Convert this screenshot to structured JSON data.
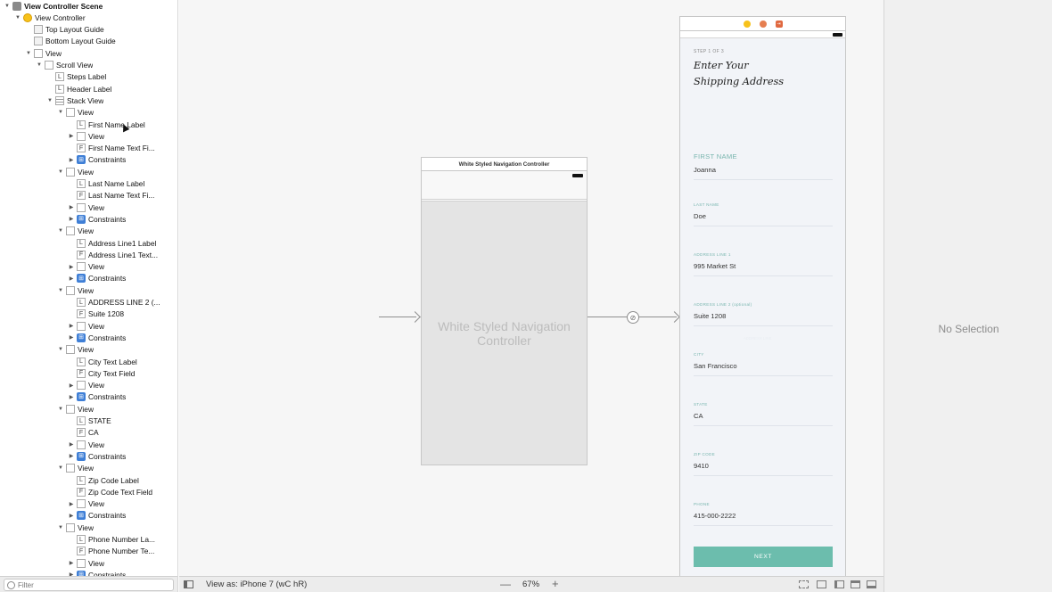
{
  "outline": {
    "items": [
      {
        "label": "View Controller Scene",
        "icon": "scene",
        "depth": 0,
        "arrow": "down",
        "bold": true
      },
      {
        "label": "View Controller",
        "icon": "vc",
        "depth": 1,
        "arrow": "down"
      },
      {
        "label": "Top Layout Guide",
        "icon": "guide",
        "depth": 2,
        "arrow": ""
      },
      {
        "label": "Bottom Layout Guide",
        "icon": "guide",
        "depth": 2,
        "arrow": ""
      },
      {
        "label": "View",
        "icon": "view",
        "depth": 2,
        "arrow": "down"
      },
      {
        "label": "Scroll View",
        "icon": "view",
        "depth": 3,
        "arrow": "down"
      },
      {
        "label": "Steps Label",
        "icon": "label",
        "depth": 4,
        "arrow": ""
      },
      {
        "label": "Header Label",
        "icon": "label",
        "depth": 4,
        "arrow": ""
      },
      {
        "label": "Stack View",
        "icon": "stack",
        "depth": 4,
        "arrow": "down"
      },
      {
        "label": "View",
        "icon": "view",
        "depth": 5,
        "arrow": "down"
      },
      {
        "label": "First Name Label",
        "icon": "label",
        "depth": 6,
        "arrow": ""
      },
      {
        "label": "View",
        "icon": "view",
        "depth": 6,
        "arrow": "right"
      },
      {
        "label": "First Name Text Fi...",
        "icon": "field",
        "depth": 6,
        "arrow": ""
      },
      {
        "label": "Constraints",
        "icon": "cons",
        "depth": 6,
        "arrow": "right"
      },
      {
        "label": "View",
        "icon": "view",
        "depth": 5,
        "arrow": "down"
      },
      {
        "label": "Last Name Label",
        "icon": "label",
        "depth": 6,
        "arrow": ""
      },
      {
        "label": "Last Name Text Fi...",
        "icon": "field",
        "depth": 6,
        "arrow": ""
      },
      {
        "label": "View",
        "icon": "view",
        "depth": 6,
        "arrow": "right"
      },
      {
        "label": "Constraints",
        "icon": "cons",
        "depth": 6,
        "arrow": "right"
      },
      {
        "label": "View",
        "icon": "view",
        "depth": 5,
        "arrow": "down"
      },
      {
        "label": "Address Line1 Label",
        "icon": "label",
        "depth": 6,
        "arrow": ""
      },
      {
        "label": "Address Line1 Text...",
        "icon": "field",
        "depth": 6,
        "arrow": ""
      },
      {
        "label": "View",
        "icon": "view",
        "depth": 6,
        "arrow": "right"
      },
      {
        "label": "Constraints",
        "icon": "cons",
        "depth": 6,
        "arrow": "right"
      },
      {
        "label": "View",
        "icon": "view",
        "depth": 5,
        "arrow": "down"
      },
      {
        "label": "ADDRESS LINE 2 (...",
        "icon": "label",
        "depth": 6,
        "arrow": ""
      },
      {
        "label": "Suite 1208",
        "icon": "field",
        "depth": 6,
        "arrow": ""
      },
      {
        "label": "View",
        "icon": "view",
        "depth": 6,
        "arrow": "right"
      },
      {
        "label": "Constraints",
        "icon": "cons",
        "depth": 6,
        "arrow": "right"
      },
      {
        "label": "View",
        "icon": "view",
        "depth": 5,
        "arrow": "down"
      },
      {
        "label": "City Text Label",
        "icon": "label",
        "depth": 6,
        "arrow": ""
      },
      {
        "label": "City Text Field",
        "icon": "field",
        "depth": 6,
        "arrow": ""
      },
      {
        "label": "View",
        "icon": "view",
        "depth": 6,
        "arrow": "right"
      },
      {
        "label": "Constraints",
        "icon": "cons",
        "depth": 6,
        "arrow": "right"
      },
      {
        "label": "View",
        "icon": "view",
        "depth": 5,
        "arrow": "down"
      },
      {
        "label": "STATE",
        "icon": "label",
        "depth": 6,
        "arrow": ""
      },
      {
        "label": "CA",
        "icon": "field",
        "depth": 6,
        "arrow": ""
      },
      {
        "label": "View",
        "icon": "view",
        "depth": 6,
        "arrow": "right"
      },
      {
        "label": "Constraints",
        "icon": "cons",
        "depth": 6,
        "arrow": "right"
      },
      {
        "label": "View",
        "icon": "view",
        "depth": 5,
        "arrow": "down"
      },
      {
        "label": "Zip Code Label",
        "icon": "label",
        "depth": 6,
        "arrow": ""
      },
      {
        "label": "Zip Code Text Field",
        "icon": "field",
        "depth": 6,
        "arrow": ""
      },
      {
        "label": "View",
        "icon": "view",
        "depth": 6,
        "arrow": "right"
      },
      {
        "label": "Constraints",
        "icon": "cons",
        "depth": 6,
        "arrow": "right"
      },
      {
        "label": "View",
        "icon": "view",
        "depth": 5,
        "arrow": "down"
      },
      {
        "label": "Phone Number La...",
        "icon": "label",
        "depth": 6,
        "arrow": ""
      },
      {
        "label": "Phone Number Te...",
        "icon": "field",
        "depth": 6,
        "arrow": ""
      },
      {
        "label": "View",
        "icon": "view",
        "depth": 6,
        "arrow": "right"
      },
      {
        "label": "Constraints",
        "icon": "cons",
        "depth": 6,
        "arrow": "right"
      }
    ],
    "filter_placeholder": "Filter"
  },
  "canvas": {
    "nav_scene": {
      "title": "White Styled Navigation Controller",
      "placeholder_line1": "White Styled Navigation",
      "placeholder_line2": "Controller"
    },
    "vc_scene": {
      "step_label": "STEP 1 OF 3",
      "header_line1": "Enter Your",
      "header_line2": "Shipping Address",
      "fields": [
        {
          "label": "FIRST NAME",
          "value": "Joanna",
          "big": true
        },
        {
          "label": "LAST NAME",
          "value": "Doe",
          "big": false
        },
        {
          "label": "ADDRESS LINE 1",
          "value": "995 Market St",
          "big": false
        },
        {
          "label": "ADDRESS LINE 2 (optional)",
          "value": "Suite 1208",
          "big": false
        },
        {
          "label": "CITY",
          "value": "San Francisco",
          "big": false
        },
        {
          "label": "STATE",
          "value": "CA",
          "big": false
        },
        {
          "label": "ZIP CODE",
          "value": "9410",
          "big": false
        },
        {
          "label": "PHONE",
          "value": "415-000-2222",
          "big": false
        }
      ],
      "ghost_label": "ADDRESS LINE",
      "next_label": "NEXT"
    }
  },
  "inspector": {
    "empty_text": "No Selection"
  },
  "bottombar": {
    "view_as": "View as: iPhone 7 (wC hR)",
    "zoom_out": "—",
    "zoom_level": "67%",
    "zoom_in": "+"
  },
  "colors": {
    "accent_teal": "#6cbdad",
    "field_label": "#78b5ae",
    "constraints_blue": "#3f7fd6"
  }
}
